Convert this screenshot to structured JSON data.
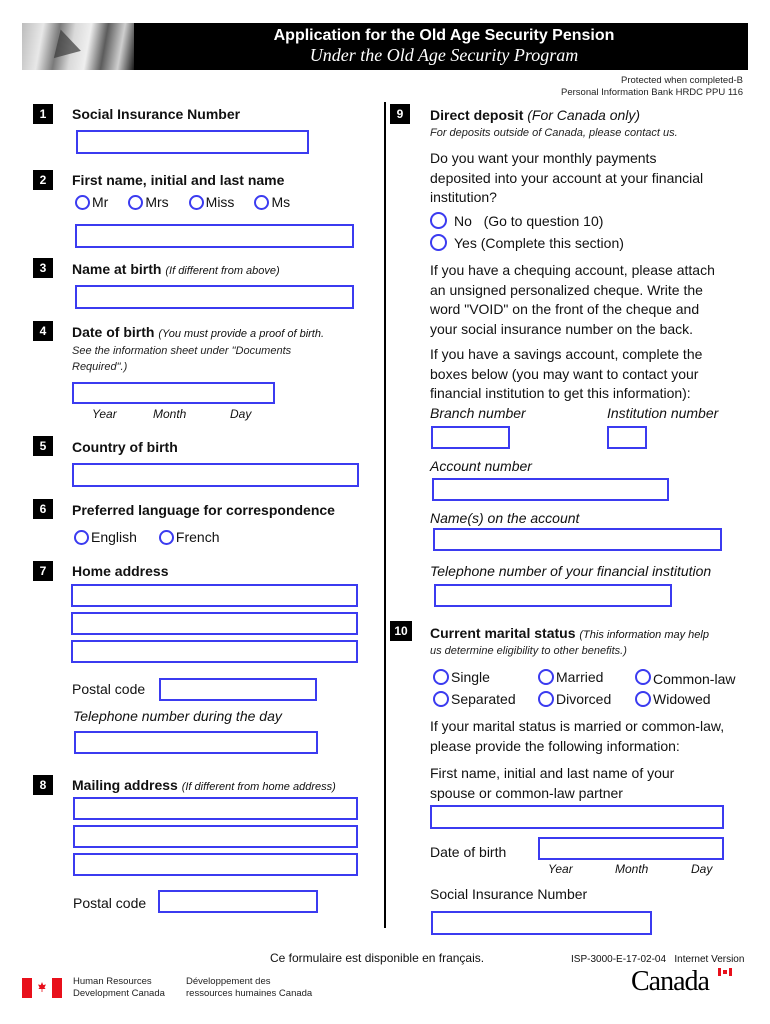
{
  "header": {
    "title": "Application for the Old Age Security Pension",
    "subtitle": "Under the Old Age Security Program",
    "protected": "Protected when completed-B",
    "info_bank": "Personal Information Bank HRDC PPU 116"
  },
  "left": {
    "q1": {
      "num": "1",
      "label": "Social Insurance Number"
    },
    "q2": {
      "num": "2",
      "label": "First name, initial and last name",
      "titles": [
        "Mr",
        "Mrs",
        "Miss",
        "Ms"
      ]
    },
    "q3": {
      "num": "3",
      "label": "Name at birth",
      "note": "(If different from above)"
    },
    "q4": {
      "num": "4",
      "label": "Date of birth",
      "note": "(You must provide a proof of birth.",
      "note2": "See the information sheet under \"Documents",
      "note3": "Required\".)",
      "parts": [
        "Year",
        "Month",
        "Day"
      ]
    },
    "q5": {
      "num": "5",
      "label": "Country of birth"
    },
    "q6": {
      "num": "6",
      "label": "Preferred language for correspondence",
      "options": [
        "English",
        "French"
      ]
    },
    "q7": {
      "num": "7",
      "label": "Home address",
      "postal_label": "Postal code",
      "phone_label": "Telephone number during the day"
    },
    "q8": {
      "num": "8",
      "label": "Mailing address",
      "note": "(If different from home address)",
      "postal_label": "Postal code"
    }
  },
  "right": {
    "q9": {
      "num": "9",
      "label": "Direct deposit",
      "note": "(For Canada only)",
      "sub": "For deposits outside of Canada, please contact us.",
      "question": [
        "Do you want your monthly payments",
        "deposited into your account at your financial",
        "institution?"
      ],
      "options": [
        "No   (Go to question 10)",
        "Yes (Complete this section)"
      ],
      "cheque_para": [
        "If you have a chequing account, please attach",
        "an unsigned personalized cheque. Write the",
        "word \"VOID\" on the front of the cheque and",
        "your social insurance number on the back."
      ],
      "savings_para": [
        "If you have a savings account, complete the",
        "boxes below (you may want to contact your",
        "financial institution to get this information):"
      ],
      "branch_label": "Branch number",
      "institution_label": "Institution number",
      "account_label": "Account number",
      "names_label": "Name(s) on the account",
      "phone_label": "Telephone number of your financial institution"
    },
    "q10": {
      "num": "10",
      "label": "Current marital status",
      "note": "(This information may help",
      "note2": "us determine eligibility to other benefits.)",
      "options": [
        "Single",
        "Married",
        "Common-law",
        "Separated",
        "Divorced",
        "Widowed"
      ],
      "para": [
        "If your marital status is married or common-law,",
        "please provide the following information:"
      ],
      "spouse_label": [
        "First name, initial and last name of your",
        "spouse or common-law partner"
      ],
      "dob_label": "Date of birth",
      "parts": [
        "Year",
        "Month",
        "Day"
      ],
      "sin_label": "Social Insurance Number"
    }
  },
  "footer": {
    "french_notice": "Ce formulaire est disponible en français.",
    "form_id": "ISP-3000-E-17-02-04   Internet Version",
    "dept_en": [
      "Human Resources",
      "Development Canada"
    ],
    "dept_fr": [
      "Développement des",
      "ressources humaines Canada"
    ],
    "wordmark": "Canada"
  },
  "colors": {
    "field_border": "#3b3bf0",
    "flag_red": "#e8101b",
    "banner": "#000000"
  }
}
